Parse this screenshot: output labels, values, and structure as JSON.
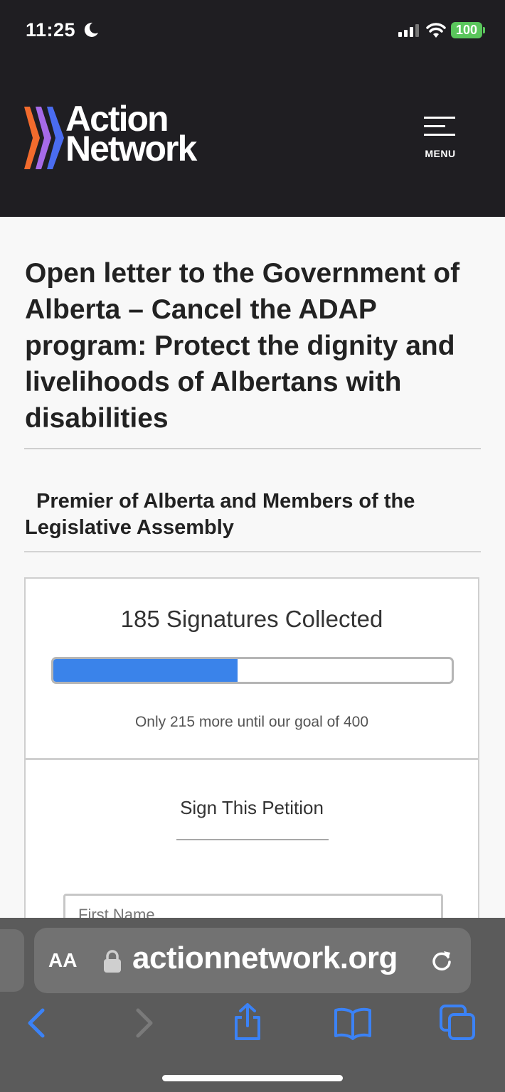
{
  "status_bar": {
    "time": "11:25",
    "battery": "100"
  },
  "header": {
    "logo_line1": "Action",
    "logo_line2": "Network",
    "menu_label": "MENU"
  },
  "page": {
    "title": "Open letter to the Government of Alberta – Cancel the ADAP program: Protect the dignity and livelihoods of Albertans with disabilities",
    "target": "Premier of Alberta and Members of the Legislative Assembly"
  },
  "signatures": {
    "collected_text": "185 Signatures Collected",
    "collected": 185,
    "goal": 400,
    "progress_fraction": 0.4625,
    "remaining_text": "Only 215 more until our goal of 400"
  },
  "form": {
    "title": "Sign This Petition",
    "first_name_placeholder": "First Name"
  },
  "browser": {
    "aa_label": "AA",
    "url": "actionnetwork.org"
  },
  "colors": {
    "header_bg": "#1f1e22",
    "progress_fill": "#3a83ea",
    "toolbar_icon": "#3b82f6",
    "logo_orange": "#f26b2d",
    "logo_purple": "#a66ae8",
    "logo_blue": "#4a6cf0"
  },
  "icons": {
    "back": "chevron-left-icon",
    "forward": "chevron-right-icon",
    "share": "share-icon",
    "bookmarks": "book-icon",
    "tabs": "tabs-icon"
  }
}
